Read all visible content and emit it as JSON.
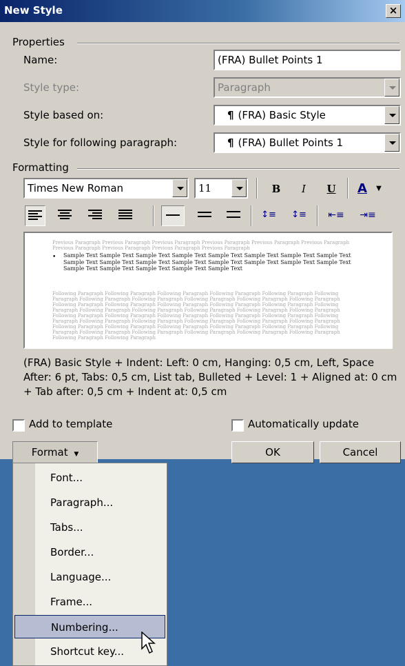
{
  "window": {
    "title": "New Style",
    "close_glyph": "×"
  },
  "properties": {
    "group_label": "Properties",
    "name_label": "Name:",
    "name_value": "(FRA) Bullet Points 1",
    "style_type_label": "Style type:",
    "style_type_value": "Paragraph",
    "based_on_label": "Style based on:",
    "based_on_value": "(FRA) Basic Style",
    "following_label": "Style for following paragraph:",
    "following_value": "(FRA) Bullet Points 1",
    "pilcrow": "¶"
  },
  "formatting": {
    "group_label": "Formatting",
    "font_value": "Times New Roman",
    "size_value": "11",
    "bold": "B",
    "italic": "I",
    "underline": "U",
    "font_color": "A",
    "font_color_hex": "#0000cc"
  },
  "preview": {
    "previous_text": "Previous Paragraph Previous Paragraph Previous Paragraph Previous Paragraph Previous Paragraph Previous Paragraph Previous Paragraph Previous Paragraph Previous Paragraph Previous Paragraph",
    "bullet": "•",
    "sample_text": "Sample Text Sample Text Sample Text Sample Text Sample Text Sample Text Sample Text Sample Text Sample Text Sample Text Sample Text Sample Text Sample Text Sample Text Sample Text Sample Text Sample Text Sample Text Sample Text Sample Text Sample Text",
    "following_text": "Following Paragraph Following Paragraph Following Paragraph Following Paragraph Following Paragraph Following Paragraph Following Paragraph Following Paragraph Following Paragraph Following Paragraph Following Paragraph Following Paragraph Following Paragraph Following Paragraph Following Paragraph Following Paragraph Following Paragraph Following Paragraph Following Paragraph Following Paragraph Following Paragraph Following Paragraph Following Paragraph Following Paragraph Following Paragraph Following Paragraph Following Paragraph Following Paragraph Following Paragraph Following Paragraph Following Paragraph Following Paragraph Following Paragraph Following Paragraph Following Paragraph Following Paragraph Following Paragraph Following Paragraph Following Paragraph Following Paragraph Following Paragraph Following Paragraph Following Paragraph Following Paragraph Following Paragraph Following Paragraph"
  },
  "description": "(FRA) Basic Style + Indent: Left:  0 cm, Hanging:  0,5 cm, Left, Space After:  6 pt, Tabs:  0,5 cm, List tab, Bulleted + Level: 1 + Aligned at: 0 cm + Tab after:  0,5 cm + Indent at:  0,5 cm",
  "options": {
    "add_to_template": "Add to template",
    "auto_update": "Automatically update"
  },
  "buttons": {
    "format": "Format",
    "ok": "OK",
    "cancel": "Cancel"
  },
  "menu": {
    "items": [
      "Font...",
      "Paragraph...",
      "Tabs...",
      "Border...",
      "Language...",
      "Frame...",
      "Numbering...",
      "Shortcut key..."
    ],
    "highlighted": "Numbering..."
  },
  "colors": {
    "desktop": "#3a6ea5",
    "dialog": "#d4d0c8",
    "menu_highlight": "#b6bdd2"
  }
}
